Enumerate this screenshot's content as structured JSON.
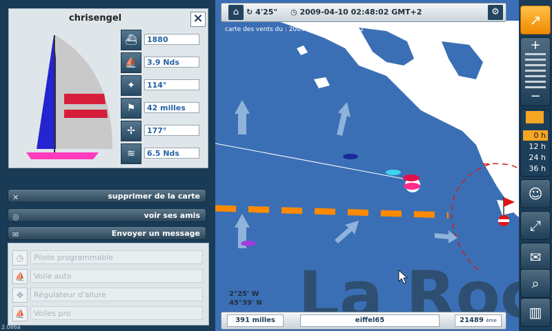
{
  "boat": {
    "name": "chrisengel",
    "close_icon": "close-icon",
    "stats": [
      {
        "icon": "boat-rank-icon",
        "value": "1880"
      },
      {
        "icon": "boat-speed-icon",
        "value": "3.9 Nds"
      },
      {
        "icon": "compass-heading-icon",
        "value": "114°"
      },
      {
        "icon": "distance-flag-icon",
        "value": "42 milles"
      },
      {
        "icon": "wind-direction-icon",
        "value": "177°"
      },
      {
        "icon": "wind-speed-icon",
        "value": "6.5 Nds"
      }
    ]
  },
  "actions": {
    "remove_label": "supprimer de la carte",
    "friends_label": "voir ses amis",
    "message_label": "Envoyer un message"
  },
  "options": [
    "Pilote programmable",
    "Voile auto",
    "Régulateur d'allure",
    "Voiles pro"
  ],
  "topbar": {
    "elapsed": "4'25\"",
    "datetime": "2009-04-10 02:48:02 GMT+2"
  },
  "map": {
    "wind_map_label": "carte des vents du :  2009-04-09 23h GMT+2",
    "place_name": "La Roc",
    "lon": "2°25' W",
    "lat": "45°39' N"
  },
  "bottombar": {
    "distance": "391 milles",
    "player": "eiffel65",
    "rank": "21489",
    "rank_suffix": "ème"
  },
  "forecast_hours": [
    "0 h",
    "12 h",
    "24 h",
    "36 h"
  ],
  "version": "2.086a",
  "colors": {
    "sea": "#3b6fb5",
    "land": "#ffffff",
    "route": "#ff8a00",
    "panel": "#1a3b56",
    "accent": "#f5a623"
  }
}
